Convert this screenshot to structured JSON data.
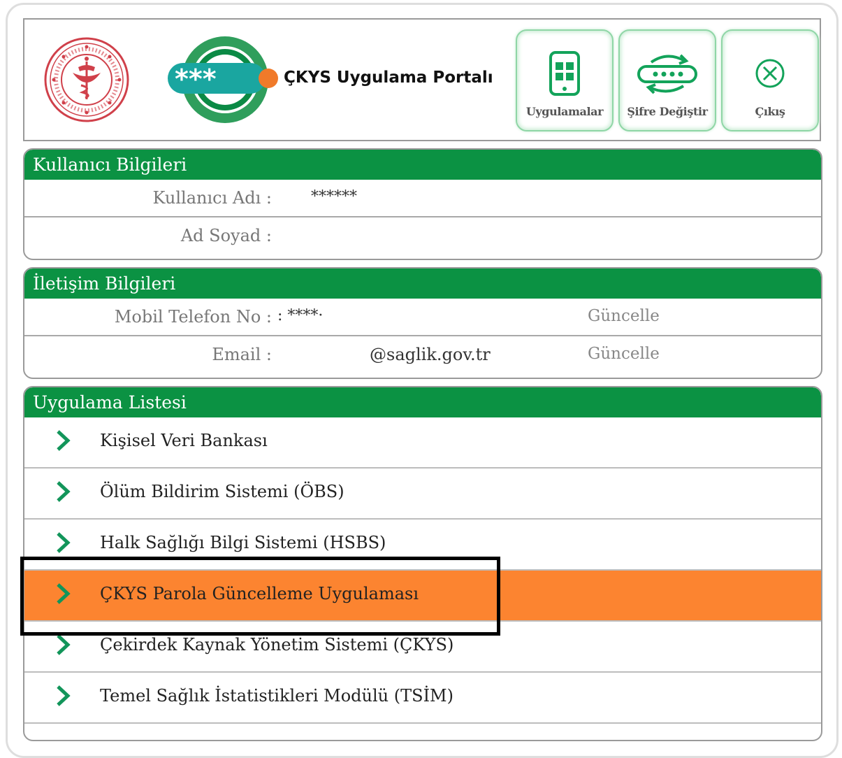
{
  "header": {
    "title": "ÇKYS Uygulama Portalı",
    "logo_text": "***",
    "buttons": [
      {
        "label": "Uygulamalar",
        "icon": "phone-apps-icon"
      },
      {
        "label": "Şifre Değiştir",
        "icon": "password-change-icon"
      },
      {
        "label": "Çıkış",
        "icon": "close-circle-icon"
      }
    ]
  },
  "user_info": {
    "title": "Kullanıcı Bilgileri",
    "username_label": "Kullanıcı Adı :",
    "username_value": "******",
    "fullname_label": "Ad Soyad :",
    "fullname_value": ""
  },
  "contact_info": {
    "title": "İletişim Bilgileri",
    "phone_label": "Mobil Telefon No :",
    "phone_value": ": ****·",
    "phone_update": "Güncelle",
    "email_label": "Email :",
    "email_value": "@saglik.gov.tr",
    "email_update": "Güncelle"
  },
  "app_list": {
    "title": "Uygulama Listesi",
    "items": [
      {
        "label": "Kişisel Veri Bankası"
      },
      {
        "label": "Ölüm Bildirim Sistemi (ÖBS)"
      },
      {
        "label": "Halk Sağlığı Bilgi Sistemi (HSBS)"
      },
      {
        "label": "ÇKYS Parola Güncelleme Uygulaması"
      },
      {
        "label": "Çekirdek Kaynak Yönetim Sistemi (ÇKYS)"
      },
      {
        "label": "Temel Sağlık İstatistikleri Modülü (TSİM)"
      }
    ],
    "active_index": 3
  },
  "colors": {
    "green": "#0b9243",
    "orange": "#fc8430",
    "chevron": "#12955a"
  }
}
